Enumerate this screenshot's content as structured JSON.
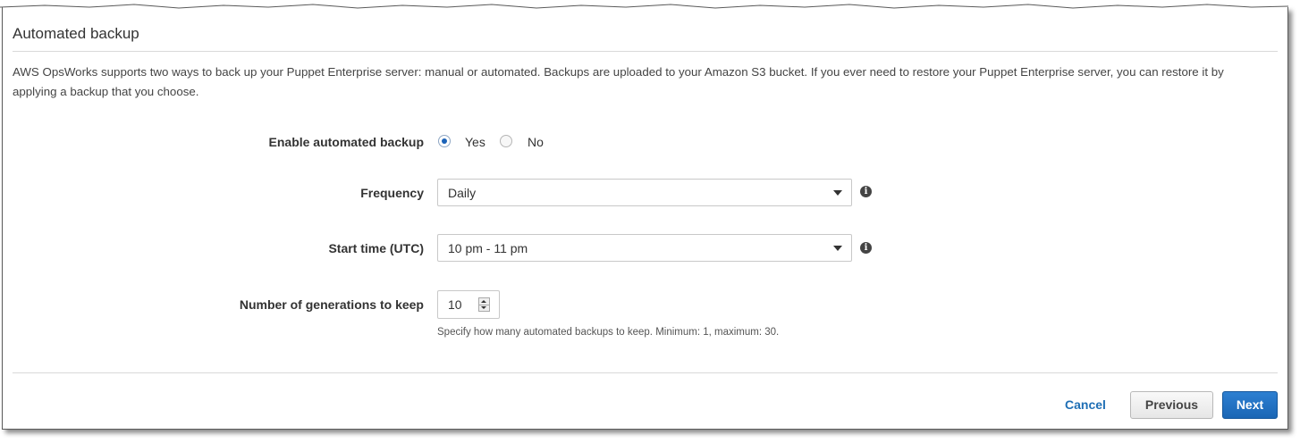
{
  "section": {
    "title": "Automated backup",
    "description": "AWS OpsWorks supports two ways to back up your Puppet Enterprise server: manual or automated. Backups are uploaded to your Amazon S3 bucket. If you ever need to restore your Puppet Enterprise server, you can restore it by applying a backup that you choose."
  },
  "form": {
    "enable_backup": {
      "label": "Enable automated backup",
      "options": [
        {
          "label": "Yes",
          "selected": true
        },
        {
          "label": "No",
          "selected": false
        }
      ]
    },
    "frequency": {
      "label": "Frequency",
      "value": "Daily",
      "info_icon": "info-circle-icon"
    },
    "start_time": {
      "label": "Start time (UTC)",
      "value": "10 pm - 11 pm",
      "info_icon": "info-circle-icon"
    },
    "generations": {
      "label": "Number of generations to keep",
      "value": "10",
      "help": "Specify how many automated backups to keep. Minimum: 1, maximum: 30."
    }
  },
  "footer": {
    "cancel_label": "Cancel",
    "previous_label": "Previous",
    "next_label": "Next"
  },
  "colors": {
    "accent": "#1c63b8",
    "link": "#1f6fb5",
    "primary_button": "#1a66b5"
  }
}
